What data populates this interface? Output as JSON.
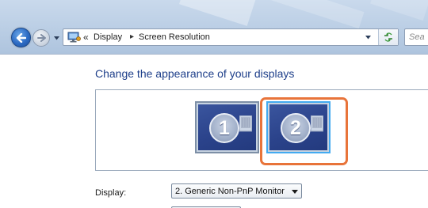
{
  "address_bar": {
    "chevrons": "«",
    "breadcrumbs": [
      {
        "label": "Display"
      },
      {
        "label": "Screen Resolution"
      }
    ],
    "separator": "▸",
    "icon": "control-panel-icon"
  },
  "search": {
    "placeholder": "Sea"
  },
  "page": {
    "heading": "Change the appearance of your displays"
  },
  "monitors": [
    {
      "number": "1",
      "selected": false
    },
    {
      "number": "2",
      "selected": true
    }
  ],
  "display_field": {
    "label": "Display:",
    "value": "2. Generic Non-PnP Monitor"
  },
  "colors": {
    "heading": "#1e3f8a",
    "selection_outline": "#e8743a",
    "monitor_fill": "#2b438b"
  }
}
